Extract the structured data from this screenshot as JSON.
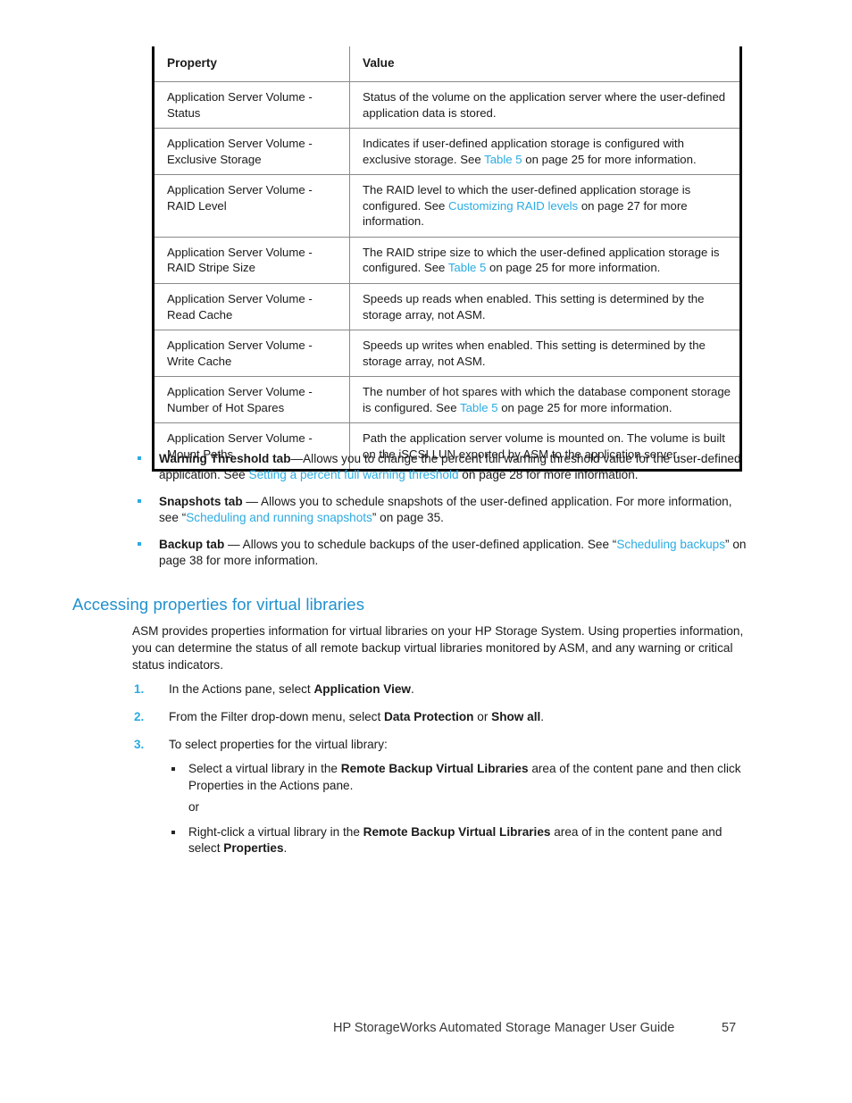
{
  "table": {
    "headers": [
      "Property",
      "Value"
    ],
    "rows": [
      {
        "property": "Application Server Volume - Status",
        "value_parts": [
          {
            "t": "Status of the volume on the application server where the user-defined application data is stored."
          }
        ]
      },
      {
        "property": "Application Server Volume - Exclusive Storage",
        "value_parts": [
          {
            "t": "Indicates if user-defined application storage is configured with exclusive storage. See "
          },
          {
            "t": "Table 5",
            "link": true
          },
          {
            "t": " on page 25 for more information."
          }
        ]
      },
      {
        "property": "Application Server Volume - RAID Level",
        "value_parts": [
          {
            "t": "The RAID level to which the user-defined application storage is configured. See "
          },
          {
            "t": "Customizing RAID levels",
            "link": true
          },
          {
            "t": " on page 27 for more information."
          }
        ]
      },
      {
        "property": "Application Server Volume - RAID Stripe Size",
        "value_parts": [
          {
            "t": "The RAID stripe size to which the user-defined application storage is configured. See "
          },
          {
            "t": "Table 5",
            "link": true
          },
          {
            "t": " on page 25 for more information."
          }
        ]
      },
      {
        "property": "Application Server Volume - Read Cache",
        "value_parts": [
          {
            "t": "Speeds up reads when enabled. This setting is determined by the storage array, not ASM."
          }
        ]
      },
      {
        "property": "Application Server Volume - Write Cache",
        "value_parts": [
          {
            "t": "Speeds up writes when enabled. This setting is determined by the storage array, not ASM."
          }
        ]
      },
      {
        "property": "Application Server Volume - Number of Hot Spares",
        "value_parts": [
          {
            "t": "The number of hot spares with which the database component storage is configured. See "
          },
          {
            "t": "Table 5",
            "link": true
          },
          {
            "t": " on page 25 for more information."
          }
        ]
      },
      {
        "property": "Application Server Volume - Mount Paths",
        "value_parts": [
          {
            "t": "Path the application server volume is mounted on. The volume is built on the iSCSI LUN exported by ASM to the application server."
          }
        ]
      }
    ]
  },
  "tab_bullets": [
    {
      "parts": [
        {
          "t": "Warning Threshold tab",
          "bold": true
        },
        {
          "t": "—Allows you to change the percent full warning threshold value for the user-defined application. See "
        },
        {
          "t": "Setting a percent full warning threshold",
          "link": true
        },
        {
          "t": " on page 28 for more information."
        }
      ]
    },
    {
      "parts": [
        {
          "t": "Snapshots tab",
          "bold": true
        },
        {
          "t": " — Allows you to schedule snapshots of the user-defined application. For more information, see “"
        },
        {
          "t": "Scheduling and running snapshots",
          "link": true
        },
        {
          "t": "” on page 35."
        }
      ]
    },
    {
      "parts": [
        {
          "t": "Backup tab",
          "bold": true
        },
        {
          "t": " — Allows you to schedule backups of the user-defined application. See “"
        },
        {
          "t": "Scheduling backups",
          "link": true
        },
        {
          "t": "” on page 38 for more information."
        }
      ]
    }
  ],
  "section": {
    "heading": "Accessing properties for virtual libraries",
    "intro": "ASM provides properties information for virtual libraries on your HP Storage System. Using properties information, you can determine the status of all remote backup virtual libraries monitored by ASM, and any warning or critical status indicators."
  },
  "steps": [
    {
      "num": "1.",
      "parts": [
        {
          "t": "In the Actions pane, select "
        },
        {
          "t": "Application View",
          "bold": true
        },
        {
          "t": "."
        }
      ]
    },
    {
      "num": "2.",
      "parts": [
        {
          "t": "From the Filter drop-down menu, select "
        },
        {
          "t": "Data Protection",
          "bold": true
        },
        {
          "t": " or "
        },
        {
          "t": "Show all",
          "bold": true
        },
        {
          "t": "."
        }
      ]
    },
    {
      "num": "3.",
      "parts": [
        {
          "t": "To select properties for the virtual library:"
        }
      ],
      "substeps": [
        {
          "parts": [
            {
              "t": "Select a virtual library in the "
            },
            {
              "t": "Remote Backup Virtual Libraries",
              "bold": true
            },
            {
              "t": " area of the content pane and then click Properties in the Actions pane."
            }
          ]
        }
      ],
      "or_text": "or",
      "substeps2": [
        {
          "parts": [
            {
              "t": "Right-click a virtual library in the "
            },
            {
              "t": "Remote Backup Virtual Libraries",
              "bold": true
            },
            {
              "t": " area of in the content pane and select "
            },
            {
              "t": "Properties",
              "bold": true
            },
            {
              "t": "."
            }
          ]
        }
      ]
    }
  ],
  "footer": {
    "title": "HP StorageWorks Automated Storage Manager User Guide",
    "page": "57"
  },
  "colors": {
    "link": "#2babe2",
    "heading": "#2191ce",
    "text": "#1a1a1a",
    "table_outer_border": "#000000",
    "table_inner_border": "#8a8a8a"
  }
}
